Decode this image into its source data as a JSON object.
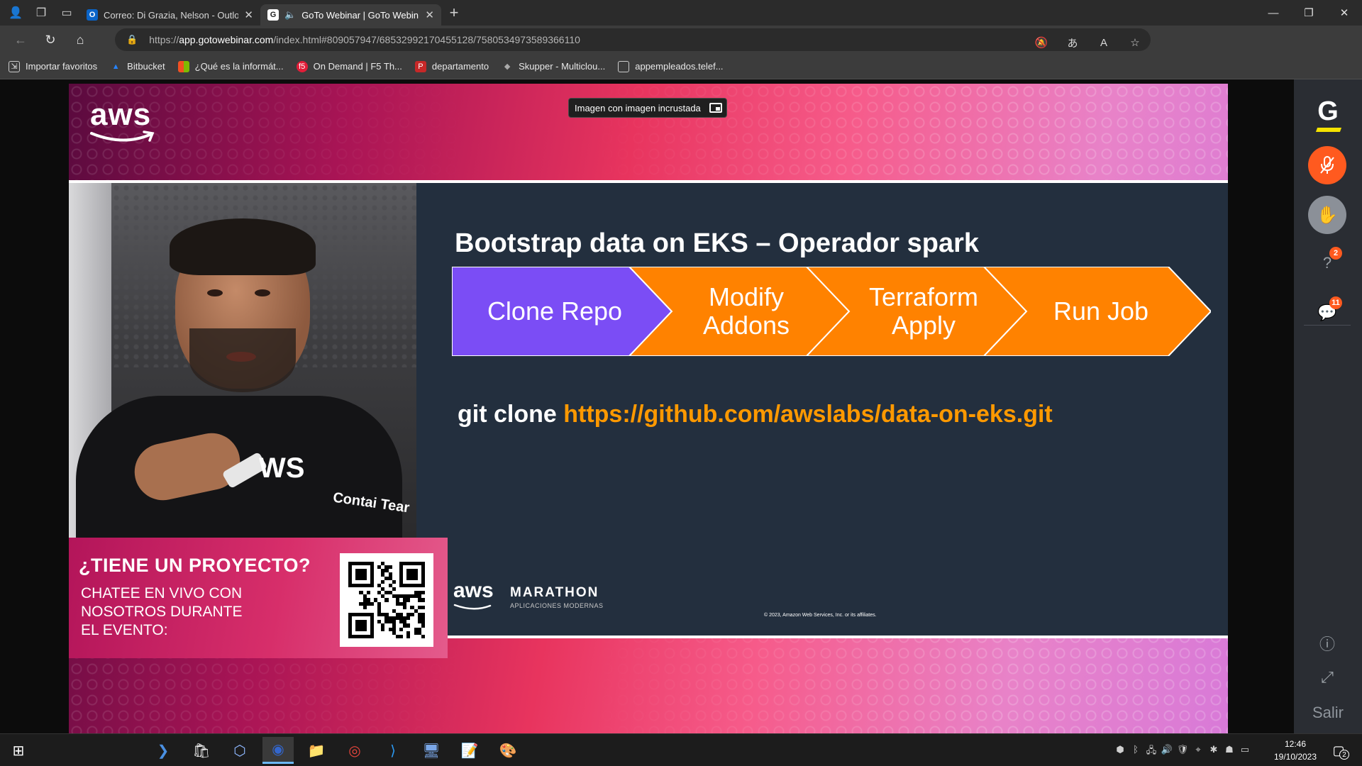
{
  "browser": {
    "tabs": [
      {
        "title": "Correo: Di Grazia, Nelson - Outlo",
        "icon": "outlook-icon",
        "active": false
      },
      {
        "title": "GoTo Webinar | GoTo Webin",
        "icon": "goto-icon",
        "active": true,
        "audio": true
      }
    ],
    "url": {
      "protocol": "https://",
      "host": "app.gotowebinar.com",
      "path": "/index.html#809057947/68532992170455128/7580534973589366110"
    },
    "bookmarks": [
      {
        "label": "Importar favoritos",
        "icon": "import-icon"
      },
      {
        "label": "Bitbucket",
        "icon": "bitbucket-icon"
      },
      {
        "label": "¿Qué es la informát...",
        "icon": "windows-icon"
      },
      {
        "label": "On Demand | F5 Th...",
        "icon": "f5-icon"
      },
      {
        "label": "departamento",
        "icon": "pdf-icon"
      },
      {
        "label": "Skupper - Multiclou...",
        "icon": "skupper-icon"
      },
      {
        "label": "appempleados.telef...",
        "icon": "page-icon"
      }
    ]
  },
  "webinar": {
    "pip_label": "Imagen con imagen incrustada",
    "aws_wordmark": "aws",
    "presenter_shirt": {
      "logo": "WS",
      "text": "Contai Tear"
    },
    "slide": {
      "title": "Bootstrap data on EKS – Operador spark",
      "steps": [
        {
          "lines": [
            "Clone Repo"
          ],
          "color": "#7b4df5"
        },
        {
          "lines": [
            "Modify",
            "Addons"
          ],
          "color": "#ff8200"
        },
        {
          "lines": [
            "Terraform",
            "Apply"
          ],
          "color": "#ff8200"
        },
        {
          "lines": [
            "Run Job"
          ],
          "color": "#ff8200"
        }
      ],
      "git_command": "git clone ",
      "git_url": "https://github.com/awslabs/data-on-eks.git",
      "footer_aws": "aws",
      "footer_marathon": "MARATHON",
      "footer_sub": "APLICACIONES MODERNAS",
      "copyright": "© 2023, Amazon Web Services, Inc. or its affiliates."
    },
    "banner": {
      "title": "¿TIENE UN PROYECTO?",
      "line1": "CHATEE EN VIVO CON",
      "line2": "NOSOTROS DURANTE",
      "line3": "EL EVENTO:"
    },
    "side_panel": {
      "questions_count": "2",
      "chat_count": "11",
      "exit_label": "Salir"
    }
  },
  "taskbar": {
    "time": "12:46",
    "date": "19/10/2023",
    "notifications": "2"
  },
  "colors": {
    "slide_bg": "#232f3e",
    "accent_orange": "#ff8200",
    "accent_purple": "#7b4df5",
    "url_orange": "#ff9900"
  }
}
